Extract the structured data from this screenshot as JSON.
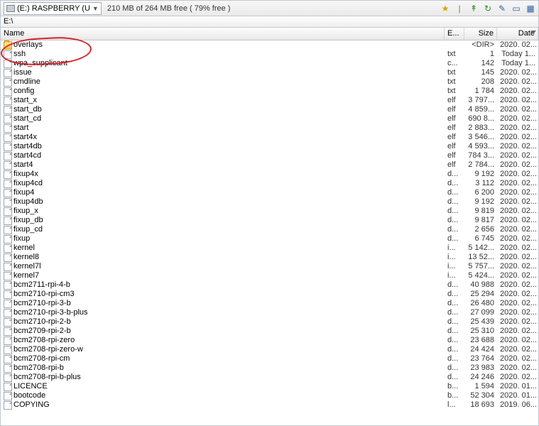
{
  "drive": {
    "label": "(E:) RASPBERRY (U"
  },
  "free_text": "210 MB of 264 MB free ( 79% free )",
  "path_text": "E:\\",
  "headers": {
    "name": "Name",
    "ext": "E...",
    "size": "Size",
    "date": "Date"
  },
  "files": [
    {
      "type": "folder",
      "name": "overlays",
      "ext": "",
      "size": "<DIR>",
      "date": "2020. 02..."
    },
    {
      "type": "file",
      "name": "ssh",
      "ext": "txt",
      "size": "1",
      "date": "Today 1..."
    },
    {
      "type": "file",
      "name": "wpa_supplicant",
      "ext": "c...",
      "size": "142",
      "date": "Today 1..."
    },
    {
      "type": "file",
      "name": "issue",
      "ext": "txt",
      "size": "145",
      "date": "2020. 02..."
    },
    {
      "type": "file",
      "name": "cmdline",
      "ext": "txt",
      "size": "208",
      "date": "2020. 02..."
    },
    {
      "type": "file",
      "name": "config",
      "ext": "txt",
      "size": "1 784",
      "date": "2020. 02..."
    },
    {
      "type": "file",
      "name": "start_x",
      "ext": "elf",
      "size": "3 797...",
      "date": "2020. 02..."
    },
    {
      "type": "file",
      "name": "start_db",
      "ext": "elf",
      "size": "4 859...",
      "date": "2020. 02..."
    },
    {
      "type": "file",
      "name": "start_cd",
      "ext": "elf",
      "size": "690 8...",
      "date": "2020. 02..."
    },
    {
      "type": "file",
      "name": "start",
      "ext": "elf",
      "size": "2 883...",
      "date": "2020. 02..."
    },
    {
      "type": "file",
      "name": "start4x",
      "ext": "elf",
      "size": "3 546...",
      "date": "2020. 02..."
    },
    {
      "type": "file",
      "name": "start4db",
      "ext": "elf",
      "size": "4 593...",
      "date": "2020. 02..."
    },
    {
      "type": "file",
      "name": "start4cd",
      "ext": "elf",
      "size": "784 3...",
      "date": "2020. 02..."
    },
    {
      "type": "file",
      "name": "start4",
      "ext": "elf",
      "size": "2 784...",
      "date": "2020. 02..."
    },
    {
      "type": "file",
      "name": "fixup4x",
      "ext": "d...",
      "size": "9 192",
      "date": "2020. 02..."
    },
    {
      "type": "file",
      "name": "fixup4cd",
      "ext": "d...",
      "size": "3 112",
      "date": "2020. 02..."
    },
    {
      "type": "file",
      "name": "fixup4",
      "ext": "d...",
      "size": "6 200",
      "date": "2020. 02..."
    },
    {
      "type": "file",
      "name": "fixup4db",
      "ext": "d...",
      "size": "9 192",
      "date": "2020. 02..."
    },
    {
      "type": "file",
      "name": "fixup_x",
      "ext": "d...",
      "size": "9 819",
      "date": "2020. 02..."
    },
    {
      "type": "file",
      "name": "fixup_db",
      "ext": "d...",
      "size": "9 817",
      "date": "2020. 02..."
    },
    {
      "type": "file",
      "name": "fixup_cd",
      "ext": "d...",
      "size": "2 656",
      "date": "2020. 02..."
    },
    {
      "type": "file",
      "name": "fixup",
      "ext": "d...",
      "size": "6 745",
      "date": "2020. 02..."
    },
    {
      "type": "file",
      "name": "kernel",
      "ext": "i...",
      "size": "5 142...",
      "date": "2020. 02..."
    },
    {
      "type": "file",
      "name": "kernel8",
      "ext": "i...",
      "size": "13 52...",
      "date": "2020. 02..."
    },
    {
      "type": "file",
      "name": "kernel7l",
      "ext": "i...",
      "size": "5 757...",
      "date": "2020. 02..."
    },
    {
      "type": "file",
      "name": "kernel7",
      "ext": "i...",
      "size": "5 424...",
      "date": "2020. 02..."
    },
    {
      "type": "file",
      "name": "bcm2711-rpi-4-b",
      "ext": "d...",
      "size": "40 988",
      "date": "2020. 02..."
    },
    {
      "type": "file",
      "name": "bcm2710-rpi-cm3",
      "ext": "d...",
      "size": "25 294",
      "date": "2020. 02..."
    },
    {
      "type": "file",
      "name": "bcm2710-rpi-3-b",
      "ext": "d...",
      "size": "26 480",
      "date": "2020. 02..."
    },
    {
      "type": "file",
      "name": "bcm2710-rpi-3-b-plus",
      "ext": "d...",
      "size": "27 099",
      "date": "2020. 02..."
    },
    {
      "type": "file",
      "name": "bcm2710-rpi-2-b",
      "ext": "d...",
      "size": "25 439",
      "date": "2020. 02..."
    },
    {
      "type": "file",
      "name": "bcm2709-rpi-2-b",
      "ext": "d...",
      "size": "25 310",
      "date": "2020. 02..."
    },
    {
      "type": "file",
      "name": "bcm2708-rpi-zero",
      "ext": "d...",
      "size": "23 688",
      "date": "2020. 02..."
    },
    {
      "type": "file",
      "name": "bcm2708-rpi-zero-w",
      "ext": "d...",
      "size": "24 424",
      "date": "2020. 02..."
    },
    {
      "type": "file",
      "name": "bcm2708-rpi-cm",
      "ext": "d...",
      "size": "23 764",
      "date": "2020. 02..."
    },
    {
      "type": "file",
      "name": "bcm2708-rpi-b",
      "ext": "d...",
      "size": "23 983",
      "date": "2020. 02..."
    },
    {
      "type": "file",
      "name": "bcm2708-rpi-b-plus",
      "ext": "d...",
      "size": "24 246",
      "date": "2020. 02..."
    },
    {
      "type": "file",
      "name": "LICENCE",
      "ext": "b...",
      "size": "1 594",
      "date": "2020. 01..."
    },
    {
      "type": "file",
      "name": "bootcode",
      "ext": "b...",
      "size": "52 304",
      "date": "2020. 01..."
    },
    {
      "type": "file",
      "name": "COPYING",
      "ext": "l...",
      "size": "18 693",
      "date": "2019. 06..."
    }
  ],
  "toolbar_icons": {
    "i1": "★",
    "i2": "|",
    "i3": "↟",
    "i4": "↻",
    "i5": "✎",
    "i6": "▭",
    "i7": "▦"
  }
}
